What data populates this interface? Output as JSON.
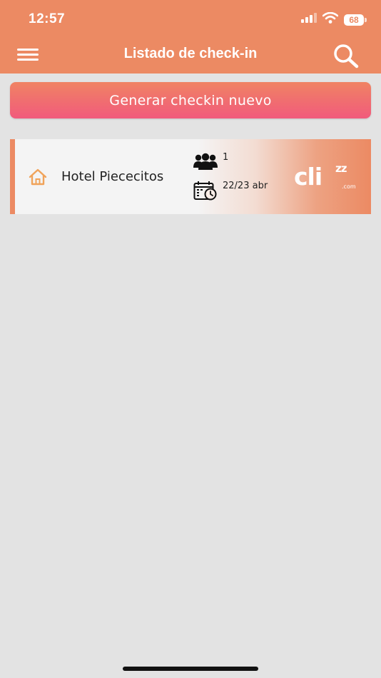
{
  "status_bar": {
    "time": "12:57",
    "battery": "68",
    "icons": [
      "signal-icon",
      "wifi-icon",
      "battery-icon"
    ]
  },
  "header": {
    "title": "Listado de check-in",
    "menu_icon": "hamburger-menu-icon",
    "search_icon": "search-icon",
    "background_color": "#ec8a63"
  },
  "new_checkin_button": {
    "label": "Generar checkin nuevo",
    "gradient": [
      "#f08363",
      "#f15a7c"
    ]
  },
  "checkins": [
    {
      "icon": "home-icon",
      "hotel_name": "Hotel Piececitos",
      "guests_icon": "group-icon",
      "guests": "1",
      "dates_icon": "calendar-clock-icon",
      "dates": "22/23 abr",
      "logo": {
        "main": "cli",
        "zz": "zz",
        "suffix": ".com"
      }
    }
  ],
  "colors": {
    "accent": "#ec8a63",
    "home_icon": "#f0a35a",
    "background": "#e3e3e3"
  }
}
